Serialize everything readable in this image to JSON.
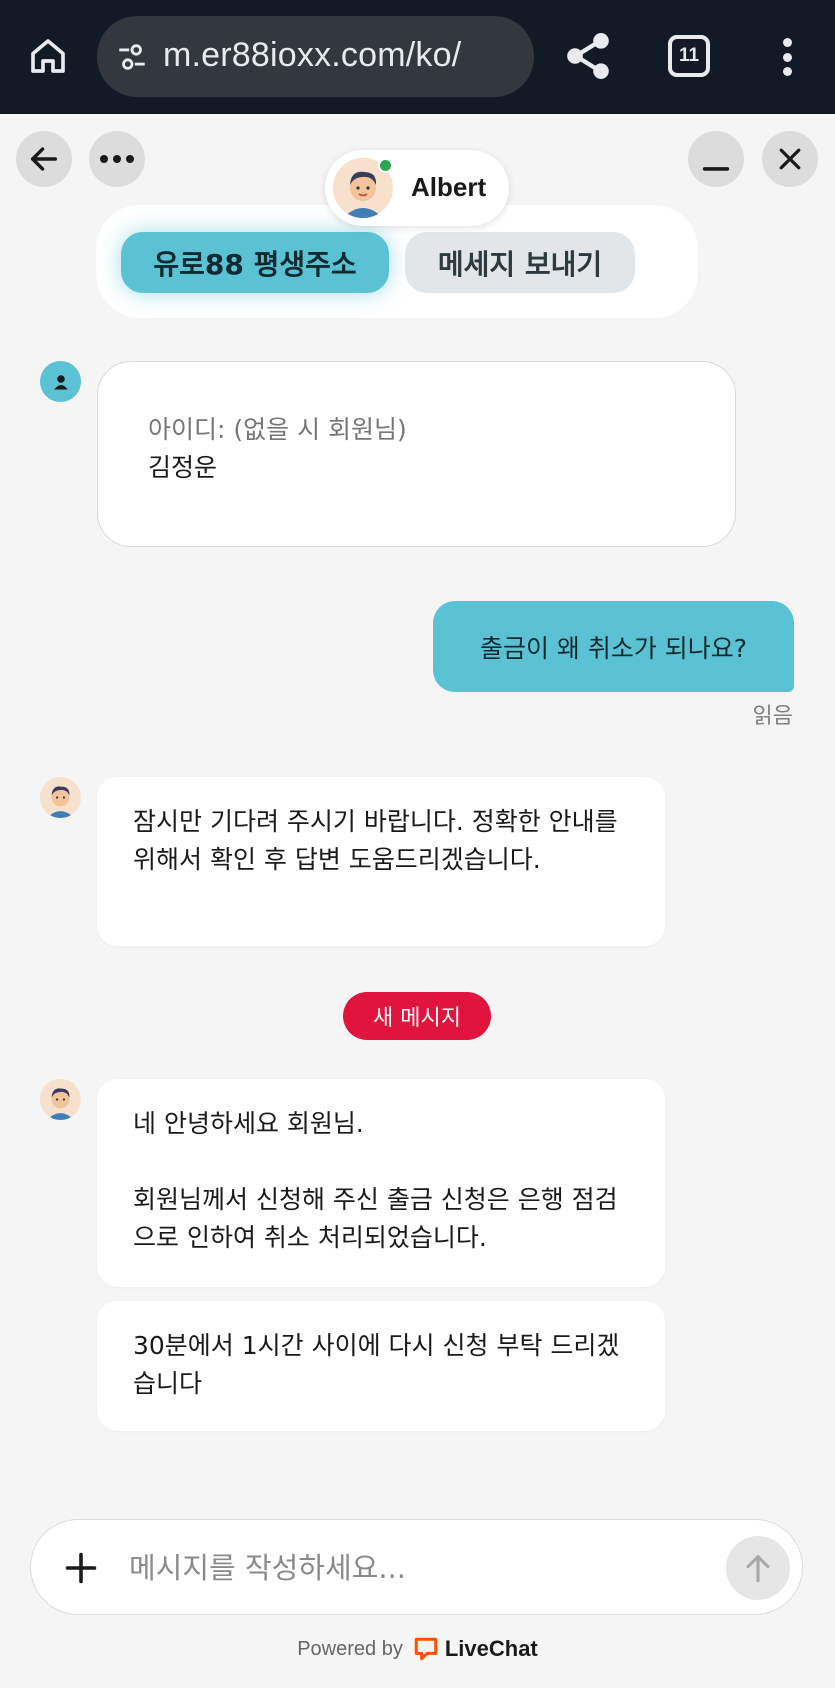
{
  "browser": {
    "url": "m.er88ioxx.com/ko/",
    "tab_count": "11"
  },
  "chat": {
    "agent_name": "Albert",
    "quick_actions": {
      "primary": "유로88 평생주소",
      "secondary": "메세지 보내기"
    },
    "form_card": {
      "label": "아이디: (없을 시 회원님)",
      "value": "김정운"
    },
    "outgoing": {
      "text": "출금이 왜 취소가 되나요?",
      "status": "읽음"
    },
    "messages": [
      {
        "text": "잠시만 기다려 주시기 바랍니다. 정확한 안내를 위해서 확인 후 답변 도움드리겠습니다."
      },
      {
        "text": "네 안녕하세요 회원님.\n\n회원님께서 신청해 주신 출금 신청은 은행 점검으로 인하여 취소 처리되었습니다."
      },
      {
        "text": "30분에서 1시간 사이에 다시 신청 부탁 드리겠습니다"
      }
    ],
    "new_message_badge": "새 메시지",
    "composer": {
      "placeholder": "메시지를 작성하세요..."
    },
    "footer": {
      "powered_by": "Powered by",
      "brand": "LiveChat"
    }
  },
  "icons": {
    "home": "home-icon",
    "site_info": "tune-icon",
    "share": "share-icon",
    "menu": "more-vert-icon",
    "back": "arrow-left-icon",
    "options": "more-horiz-icon",
    "minimize": "minimize-icon",
    "close": "close-icon",
    "attach": "plus-icon",
    "send": "arrow-up-icon"
  },
  "colors": {
    "accent": "#5bc2d4",
    "badge": "#e0143c",
    "browser_bar": "#121a26",
    "online": "#2da44e"
  }
}
